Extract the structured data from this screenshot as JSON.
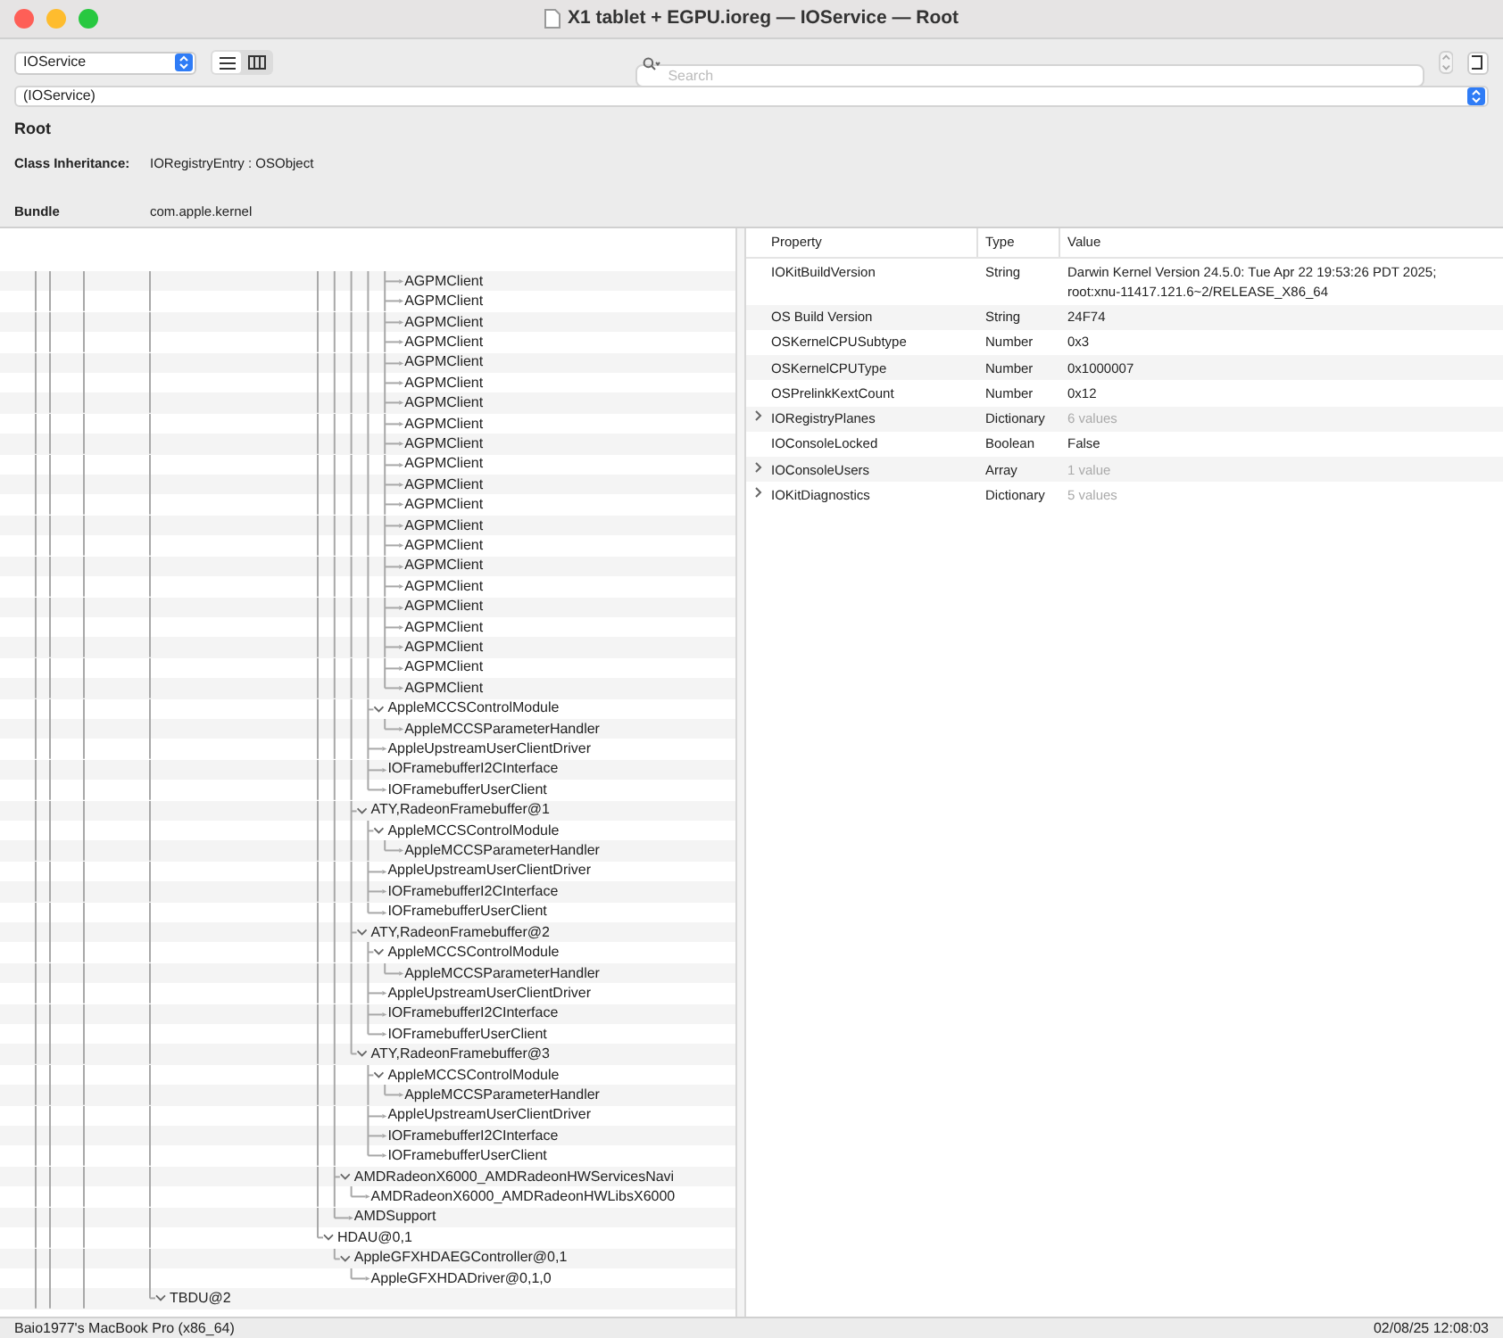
{
  "window": {
    "title": "X1 tablet + EGPU.ioreg — IOService — Root"
  },
  "toolbar": {
    "plane": "IOService",
    "views": [
      {
        "kind": "list",
        "selected": true
      },
      {
        "kind": "columns",
        "selected": false
      }
    ],
    "search": {
      "placeholder": "Search"
    }
  },
  "path": "(IOService)",
  "info": {
    "title": "Root",
    "fields": [
      {
        "label": "Class Inheritance:",
        "value": "IORegistryEntry : OSObject"
      },
      {
        "label": "Bundle",
        "value": "com.apple.kernel"
      }
    ]
  },
  "tree": [
    {
      "children": [
        {
          "children": [
            {
              "children": [
                {
                  "children": [
                    {
                      "children": [
                        {
                          "children": [
                            {
                              "children": [
                                {
                                  "children": [
                                    {
                                      "children": [
                                        {
                                          "children": [
                                            {
                                              "children": [
                                                {
                                                  "children": [
                                                    {
                                                      "children": [
                                                        {
                                                          "children": [
                                                            {
                                                              "label": "AGPMClient"
                                                            },
                                                            {
                                                              "label": "AGPMClient"
                                                            },
                                                            {
                                                              "label": "AGPMClient"
                                                            },
                                                            {
                                                              "label": "AGPMClient"
                                                            },
                                                            {
                                                              "label": "AGPMClient"
                                                            },
                                                            {
                                                              "label": "AGPMClient"
                                                            },
                                                            {
                                                              "label": "AGPMClient"
                                                            },
                                                            {
                                                              "label": "AGPMClient"
                                                            },
                                                            {
                                                              "label": "AGPMClient"
                                                            },
                                                            {
                                                              "label": "AGPMClient"
                                                            },
                                                            {
                                                              "label": "AGPMClient"
                                                            },
                                                            {
                                                              "label": "AGPMClient"
                                                            },
                                                            {
                                                              "label": "AGPMClient"
                                                            },
                                                            {
                                                              "label": "AGPMClient"
                                                            },
                                                            {
                                                              "label": "AGPMClient"
                                                            },
                                                            {
                                                              "label": "AGPMClient"
                                                            },
                                                            {
                                                              "label": "AGPMClient"
                                                            },
                                                            {
                                                              "label": "AGPMClient"
                                                            },
                                                            {
                                                              "label": "AGPMClient"
                                                            },
                                                            {
                                                              "label": "AGPMClient"
                                                            },
                                                            {
                                                              "label": "AGPMClient"
                                                            }
                                                          ]
                                                        },
                                                        {
                                                          "label": "AppleMCCSControlModule",
                                                          "expanded": true,
                                                          "children": [
                                                            {
                                                              "label": "AppleMCCSParameterHandler"
                                                            }
                                                          ]
                                                        },
                                                        {
                                                          "label": "AppleUpstreamUserClientDriver"
                                                        },
                                                        {
                                                          "label": "IOFramebufferI2CInterface"
                                                        },
                                                        {
                                                          "label": "IOFramebufferUserClient"
                                                        }
                                                      ]
                                                    },
                                                    {
                                                      "label": "ATY,RadeonFramebuffer@1",
                                                      "expanded": true,
                                                      "children": [
                                                        {
                                                          "label": "AppleMCCSControlModule",
                                                          "expanded": true,
                                                          "children": [
                                                            {
                                                              "label": "AppleMCCSParameterHandler"
                                                            }
                                                          ]
                                                        },
                                                        {
                                                          "label": "AppleUpstreamUserClientDriver"
                                                        },
                                                        {
                                                          "label": "IOFramebufferI2CInterface"
                                                        },
                                                        {
                                                          "label": "IOFramebufferUserClient"
                                                        }
                                                      ]
                                                    },
                                                    {
                                                      "label": "ATY,RadeonFramebuffer@2",
                                                      "expanded": true,
                                                      "children": [
                                                        {
                                                          "label": "AppleMCCSControlModule",
                                                          "expanded": true,
                                                          "children": [
                                                            {
                                                              "label": "AppleMCCSParameterHandler"
                                                            }
                                                          ]
                                                        },
                                                        {
                                                          "label": "AppleUpstreamUserClientDriver"
                                                        },
                                                        {
                                                          "label": "IOFramebufferI2CInterface"
                                                        },
                                                        {
                                                          "label": "IOFramebufferUserClient"
                                                        }
                                                      ]
                                                    },
                                                    {
                                                      "label": "ATY,RadeonFramebuffer@3",
                                                      "expanded": true,
                                                      "children": [
                                                        {
                                                          "label": "AppleMCCSControlModule",
                                                          "expanded": true,
                                                          "children": [
                                                            {
                                                              "label": "AppleMCCSParameterHandler"
                                                            }
                                                          ]
                                                        },
                                                        {
                                                          "label": "AppleUpstreamUserClientDriver"
                                                        },
                                                        {
                                                          "label": "IOFramebufferI2CInterface"
                                                        },
                                                        {
                                                          "label": "IOFramebufferUserClient"
                                                        }
                                                      ]
                                                    }
                                                  ]
                                                },
                                                {
                                                  "label": "AMDRadeonX6000_AMDRadeonHWServicesNavi",
                                                  "expanded": true,
                                                  "children": [
                                                    {
                                                      "label": "AMDRadeonX6000_AMDRadeonHWLibsX6000"
                                                    }
                                                  ]
                                                },
                                                {
                                                  "label": "AMDSupport"
                                                }
                                              ]
                                            },
                                            {
                                              "label": "HDAU@0,1",
                                              "expanded": true,
                                              "children": [
                                                {
                                                  "label": "AppleGFXHDAEGController@0,1",
                                                  "expanded": true,
                                                  "children": [
                                                    {
                                                      "label": "AppleGFXHDADriver@0,1,0"
                                                    }
                                                  ]
                                                }
                                              ]
                                            }
                                          ]
                                        }
                                      ]
                                    }
                                  ]
                                }
                              ]
                            }
                          ]
                        }
                      ]
                    }
                  ]
                }
              ]
            }
          ]
        }
      ]
    },
    {
      "label": "TBDU@2",
      "expanded": true
    }
  ],
  "properties": {
    "columns": [
      "Property",
      "Type",
      "Value"
    ],
    "rows": [
      {
        "kind": "value",
        "property": "IOKitBuildVersion",
        "type": "String",
        "value": "Darwin Kernel Version 24.5.0: Tue Apr 22 19:53:26 PDT 2025; root:xnu-11417.121.6~2/RELEASE_X86_64"
      },
      {
        "kind": "value",
        "property": "OS Build Version",
        "type": "String",
        "value": "24F74"
      },
      {
        "kind": "value",
        "property": "OSKernelCPUSubtype",
        "type": "Number",
        "value": "0x3"
      },
      {
        "kind": "value",
        "property": "OSKernelCPUType",
        "type": "Number",
        "value": "0x1000007"
      },
      {
        "kind": "value",
        "property": "OSPrelinkKextCount",
        "type": "Number",
        "value": "0x12"
      },
      {
        "kind": "group",
        "expanded": false,
        "property": "IORegistryPlanes",
        "type": "Dictionary",
        "value": "6 values"
      },
      {
        "kind": "value",
        "property": "IOConsoleLocked",
        "type": "Boolean",
        "value": "False"
      },
      {
        "kind": "group",
        "expanded": false,
        "property": "IOConsoleUsers",
        "type": "Array",
        "value": "1 value"
      },
      {
        "kind": "group",
        "expanded": false,
        "property": "IOKitDiagnostics",
        "type": "Dictionary",
        "value": "5 values"
      }
    ]
  },
  "status_bar": {
    "machine": "Baio1977's MacBook Pro (x86_64)",
    "timestamp": "02/08/25 12:08:03"
  }
}
